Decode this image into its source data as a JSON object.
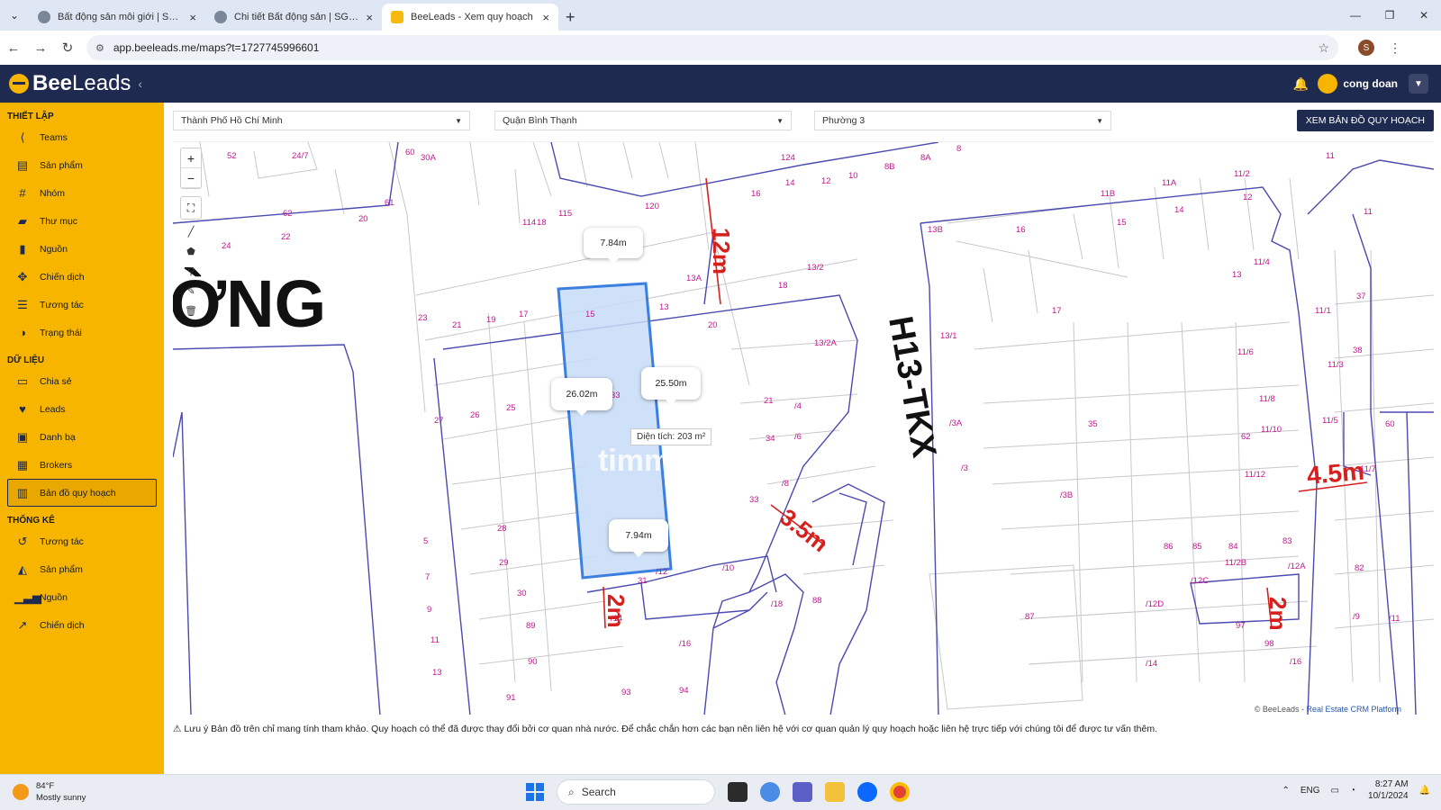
{
  "browser": {
    "tabs": [
      {
        "title": "Bất động sản môi giới | SGCR C"
      },
      {
        "title": "Chi tiết Bất động sản | SGCR Cr"
      },
      {
        "title": "BeeLeads - Xem quy hoạch"
      }
    ],
    "url": "app.beeleads.me/maps?t=1727745996601",
    "profile_initial": "S"
  },
  "app": {
    "logo_part1": "Bee",
    "logo_part2": "Leads",
    "user_name": "cong doan"
  },
  "sidebar": {
    "sections": [
      {
        "title": "THIẾT LẬP",
        "items": [
          "Teams",
          "Sản phẩm",
          "Nhóm",
          "Thư mục",
          "Nguồn",
          "Chiến dịch",
          "Tương tác",
          "Trạng thái"
        ]
      },
      {
        "title": "DỮ LIỆU",
        "items": [
          "Chia sẻ",
          "Leads",
          "Danh bạ",
          "Brokers",
          "Bản đồ quy hoạch"
        ]
      },
      {
        "title": "THỐNG KÊ",
        "items": [
          "Tương tác",
          "Sản phẩm",
          "Nguồn",
          "Chiến dịch"
        ]
      }
    ]
  },
  "filters": {
    "city": "Thành Phố Hồ Chí Minh",
    "district": "Quận Bình Thạnh",
    "ward": "Phường 3",
    "view_button": "XEM BẢN ĐỒ QUY HOẠCH"
  },
  "map": {
    "zoom_in": "+",
    "zoom_out": "−",
    "callouts": {
      "top": "7.84m",
      "left": "26.02m",
      "right": "25.50m",
      "bottom": "7.94m"
    },
    "area_label": "Diện tích:",
    "area_value": "203 m²",
    "road_label": "H13-TKX",
    "big_text": "ỜNG",
    "watermark": "timm",
    "widths": [
      "12m",
      "3.5m",
      "2m",
      "4.5m",
      "2m"
    ],
    "lot_numbers": [
      "52",
      "24/7",
      "60",
      "30A",
      "114",
      "18",
      "115",
      "120",
      "124",
      "14",
      "12",
      "10",
      "8B",
      "8A",
      "8",
      "16",
      "62",
      "61",
      "20",
      "22",
      "24",
      "13A",
      "13",
      "13/2",
      "18",
      "15",
      "23",
      "21",
      "19",
      "17",
      "20",
      "13/2A",
      "33",
      "26",
      "25",
      "27",
      "21",
      "/4",
      "34",
      "/6",
      "28",
      "29",
      "30",
      "31",
      "/8",
      "33",
      "/10",
      "/12",
      "5",
      "7",
      "9",
      "11",
      "13",
      "89",
      "90",
      "91",
      "93",
      "94",
      "/16",
      "/14",
      "/18",
      "88",
      "13B",
      "16",
      "11B",
      "11A",
      "15",
      "14",
      "11/2",
      "12",
      "11",
      "11/4",
      "17",
      "13/1",
      "/3A",
      "35",
      "/3",
      "/3B",
      "11/6",
      "11/8",
      "11/10",
      "62",
      "11/12",
      "11/5",
      "11/7",
      "86",
      "85",
      "84",
      "83",
      "11/2B",
      "/12C",
      "/12D",
      "/12A",
      "/14",
      "/16",
      "87",
      "97",
      "98",
      "82",
      "/9",
      "/11",
      "37",
      "38",
      "60",
      "11/1",
      "11/3",
      "13",
      "11"
    ],
    "attribution_prefix": "© BeeLeads - ",
    "attribution_link": "Real Estate CRM Platform"
  },
  "note": "Lưu ý Bản đồ trên chỉ mang tính tham khảo. Quy hoạch có thể đã được thay đổi bởi cơ quan nhà nước. Để chắc chắn hơn các bạn nên liên hệ với cơ quan quản lý quy hoạch hoặc liên hệ trực tiếp với chúng tôi để được tư vấn thêm.",
  "taskbar": {
    "temp": "84°F",
    "weather": "Mostly sunny",
    "search_placeholder": "Search",
    "lang": "ENG",
    "time": "8:27 AM",
    "date": "10/1/2024"
  },
  "colors": {
    "brand_yellow": "#f7b500",
    "navy": "#1e2a4f",
    "lot_line": "#4a4ab0",
    "lot_label": "#c2188e",
    "selection_fill": "#c7dcf7",
    "selection_stroke": "#3b7fe0",
    "width_red": "#d6201e"
  }
}
